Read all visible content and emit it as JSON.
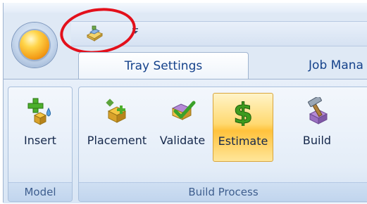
{
  "qat": {
    "button_icon": "tray-folder-icon",
    "dropdown_icon": "chevron-down-icon"
  },
  "tabs": [
    {
      "label": "Tray Settings",
      "active": true
    },
    {
      "label": "Job Mana",
      "active": false
    }
  ],
  "groups": {
    "model": {
      "label": "Model",
      "buttons": [
        {
          "label": "Insert",
          "icon": "insert-model-icon"
        }
      ]
    },
    "build_process": {
      "label": "Build Process",
      "buttons": [
        {
          "label": "Placement",
          "icon": "placement-icon"
        },
        {
          "label": "Validate",
          "icon": "validate-icon"
        },
        {
          "label": "Estimate",
          "icon": "dollar-icon",
          "active": true
        },
        {
          "label": "Build",
          "icon": "hammer-icon"
        }
      ]
    }
  },
  "colors": {
    "accent_text": "#15428b",
    "highlight_circle": "#e3101b",
    "active_button": "#ffd970"
  }
}
